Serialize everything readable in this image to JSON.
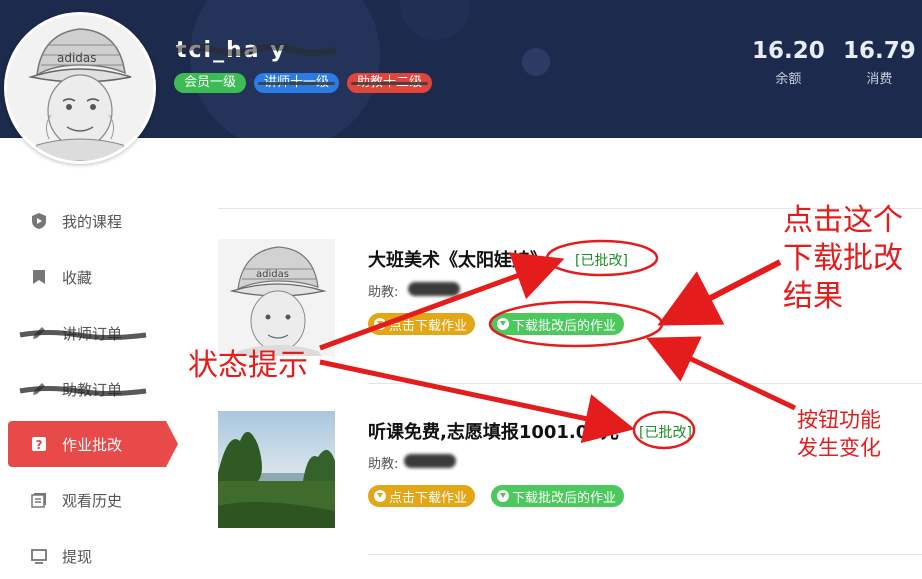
{
  "profile": {
    "username": "tci_ha y",
    "badges": [
      "会员一级",
      "讲师十一级",
      "助教十二级"
    ],
    "stats": [
      {
        "value": "16.20",
        "label": "余额"
      },
      {
        "value": "16.79",
        "label": "消费"
      }
    ]
  },
  "sidebar": {
    "items": [
      {
        "label": "我的课程",
        "icon": "shield-icon"
      },
      {
        "label": "收藏",
        "icon": "bookmark-icon"
      },
      {
        "label": "讲师订单",
        "icon": "edit-icon"
      },
      {
        "label": "助教订单",
        "icon": "edit-icon"
      },
      {
        "label": "作业批改",
        "icon": "question-icon"
      },
      {
        "label": "观看历史",
        "icon": "history-icon"
      },
      {
        "label": "提现",
        "icon": "withdraw-icon"
      }
    ],
    "active_index": 4
  },
  "courses": [
    {
      "title": "大班美术《太阳娃娃》",
      "status": "[已批改]",
      "assistant_label": "助教:",
      "buttons": [
        "点击下载作业",
        "下载批改后的作业"
      ]
    },
    {
      "title": "听课免费,志愿填报1001.00元",
      "status": "[已批改]",
      "assistant_label": "助教:",
      "buttons": [
        "点击下载作业",
        "下载批改后的作业"
      ]
    }
  ],
  "annotations": {
    "status_hint": "状态提示",
    "click_download_line1": "点击这个",
    "click_download_line2": "下载批改",
    "click_download_line3": "结果",
    "button_change_line1": "按钮功能",
    "button_change_line2": "发生变化"
  },
  "colors": {
    "header_bg": "#1c2a4d",
    "active_red": "#e84a4a",
    "annotation_red": "#e51c1c",
    "download_orange": "#e3a616",
    "download_green": "#4cc95d",
    "status_green": "#1a8f2a"
  }
}
